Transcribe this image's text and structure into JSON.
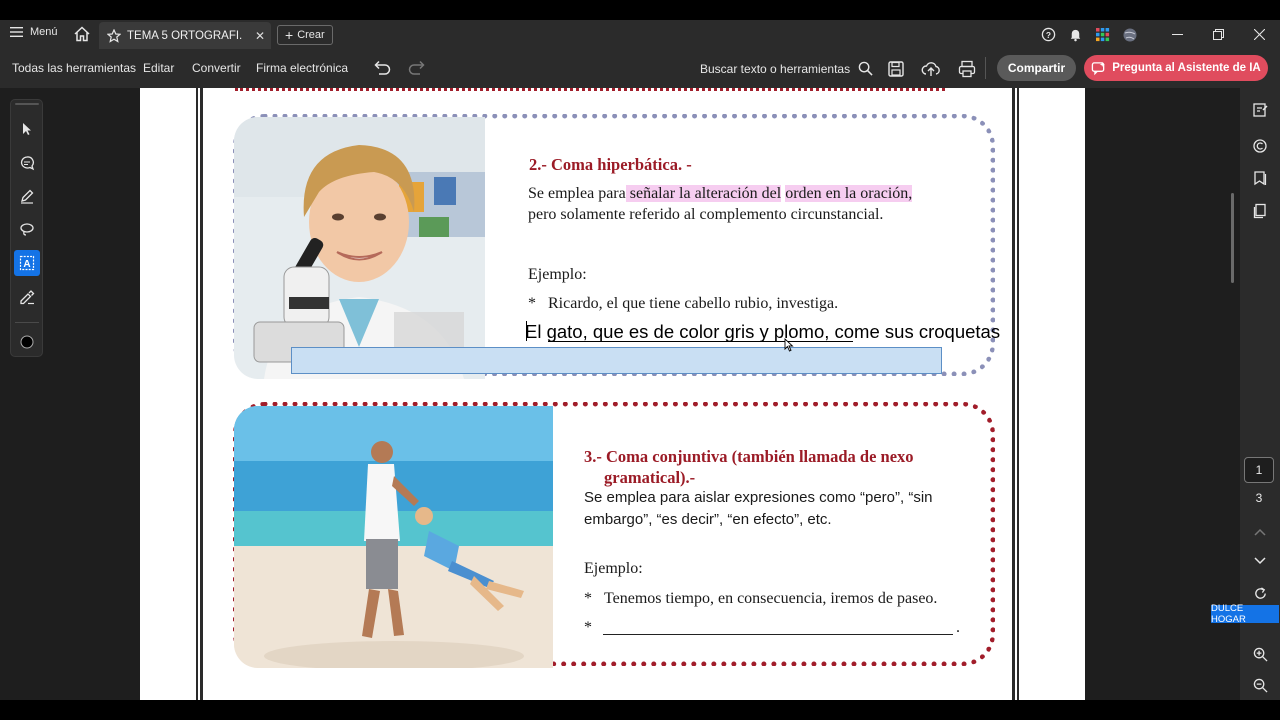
{
  "titlebar": {
    "menu_label": "Menú",
    "tab_title": "TEMA 5 ORTOGRAFÍ...",
    "new_tab_label": "Crear"
  },
  "toolbar": {
    "all_tools": "Todas las herramientas",
    "edit": "Editar",
    "convert": "Convertir",
    "esign": "Firma electrónica",
    "search_label": "Buscar texto o herramientas",
    "share_label": "Compartir",
    "ai_label": "Pregunta al Asistente de IA"
  },
  "colors": {
    "accent": "#1473e6",
    "ai_button": "#e04c5e",
    "heading_red": "#9b1b26",
    "highlight_pink": "#f6cdf0"
  },
  "document": {
    "section2": {
      "heading": "2.- Coma hiperbática. -",
      "line1_pre": "Se emplea  para",
      "line1_hl1": " señalar la alteración del",
      "line1_mid": " ",
      "line1_hl2": "orden en la oración,",
      "line2": "pero solamente referido al complemento circunstancial.",
      "example_label": "Ejemplo:",
      "bullet": "*",
      "example1": "Ricardo, el que tiene cabello rubio, investiga.",
      "typed_text": "El gato, que es de color gris y plomo, come sus croquetas"
    },
    "section3": {
      "heading_line1": "3.- Coma conjuntiva (también llamada de nexo",
      "heading_line2": "gramatical).-",
      "body_line1": "Se emplea  para aislar expresiones como “pero”, “sin",
      "body_line2": "embargo”, “es decir”, “en efecto”, etc.",
      "example_label": "Ejemplo:",
      "bullet": "*",
      "example1": "Tenemos tiempo, en consecuencia, iremos de paseo.",
      "blank_end": "."
    }
  },
  "right_panel": {
    "current_page": "1",
    "total_pages": "3",
    "label_badge": "DULCE HOGAR"
  },
  "icons": [
    "menu-icon",
    "home-icon",
    "star-icon",
    "close-icon",
    "plus-icon",
    "help-icon",
    "bell-icon",
    "apps-icon",
    "globe-icon",
    "minimize-icon",
    "restore-icon",
    "window-close-icon",
    "undo-icon",
    "redo-icon",
    "search-icon",
    "save-icon",
    "upload-icon",
    "print-icon",
    "ai-icon",
    "select-arrow-icon",
    "comment-icon",
    "pen-icon",
    "lasso-icon",
    "text-box-icon",
    "fill-sign-icon",
    "color-dot-icon",
    "edit-panel-icon",
    "comments-panel-icon",
    "bookmarks-icon",
    "pages-icon",
    "chevron-up-icon",
    "chevron-down-icon",
    "refresh-icon",
    "zoom-in-icon",
    "zoom-out-icon"
  ]
}
